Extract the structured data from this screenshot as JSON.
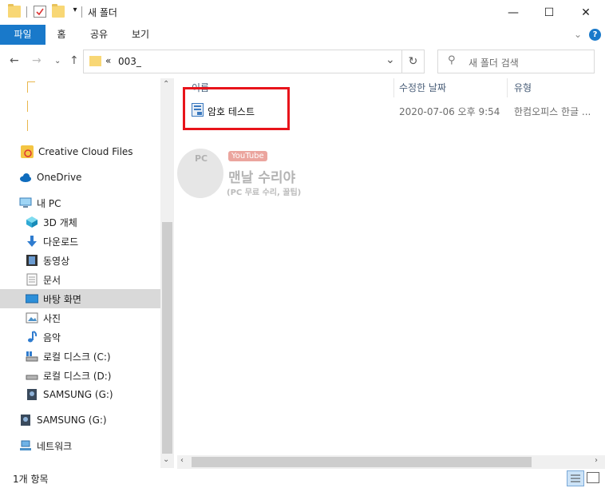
{
  "window": {
    "title": "새 폴더",
    "min_glyph": "—",
    "max_glyph": "☐",
    "close_glyph": "✕"
  },
  "ribbon": {
    "tabs": [
      "파일",
      "홈",
      "공유",
      "보기"
    ],
    "expand_glyph": "⌄",
    "help_glyph": "?"
  },
  "address": {
    "chevrons": "«",
    "path": "003_",
    "dropdown_glyph": "⌄",
    "refresh_glyph": "↻",
    "search_placeholder": "새 폴더 검색"
  },
  "nav": {
    "items": [
      {
        "label": "Creative Cloud Files",
        "icon": "creative-cloud-icon"
      },
      {
        "label": "OneDrive",
        "icon": "onedrive-icon"
      },
      {
        "label": "내 PC",
        "icon": "pc-icon"
      },
      {
        "label": "3D 개체",
        "icon": "3d-objects-icon"
      },
      {
        "label": "다운로드",
        "icon": "download-icon"
      },
      {
        "label": "동영상",
        "icon": "video-icon"
      },
      {
        "label": "문서",
        "icon": "document-icon"
      },
      {
        "label": "바탕 화면",
        "icon": "desktop-icon",
        "selected": true
      },
      {
        "label": "사진",
        "icon": "pictures-icon"
      },
      {
        "label": "음악",
        "icon": "music-icon"
      },
      {
        "label": "로컬 디스크 (C:)",
        "icon": "drive-icon"
      },
      {
        "label": "로컬 디스크 (D:)",
        "icon": "drive-icon"
      },
      {
        "label": "SAMSUNG (G:)",
        "icon": "usb-drive-icon"
      },
      {
        "label": "SAMSUNG (G:)",
        "icon": "usb-drive-icon"
      },
      {
        "label": "네트워크",
        "icon": "network-icon"
      }
    ]
  },
  "columns": {
    "name": "이름",
    "date": "수정한 날짜",
    "type": "유형"
  },
  "files": [
    {
      "name": "암호 테스트",
      "date": "2020-07-06 오후 9:54",
      "type": "한컴오피스 한글 ..."
    }
  ],
  "watermark": {
    "badge": "PC",
    "platform": "YouTube",
    "title": "맨날 수리야",
    "subtitle": "(PC 무료 수리, 꿀팁)"
  },
  "status": {
    "count": "1개 항목"
  },
  "colors": {
    "accent": "#1979ca",
    "highlight_box": "#e8141b",
    "selected_nav": "#d9d9d9"
  }
}
